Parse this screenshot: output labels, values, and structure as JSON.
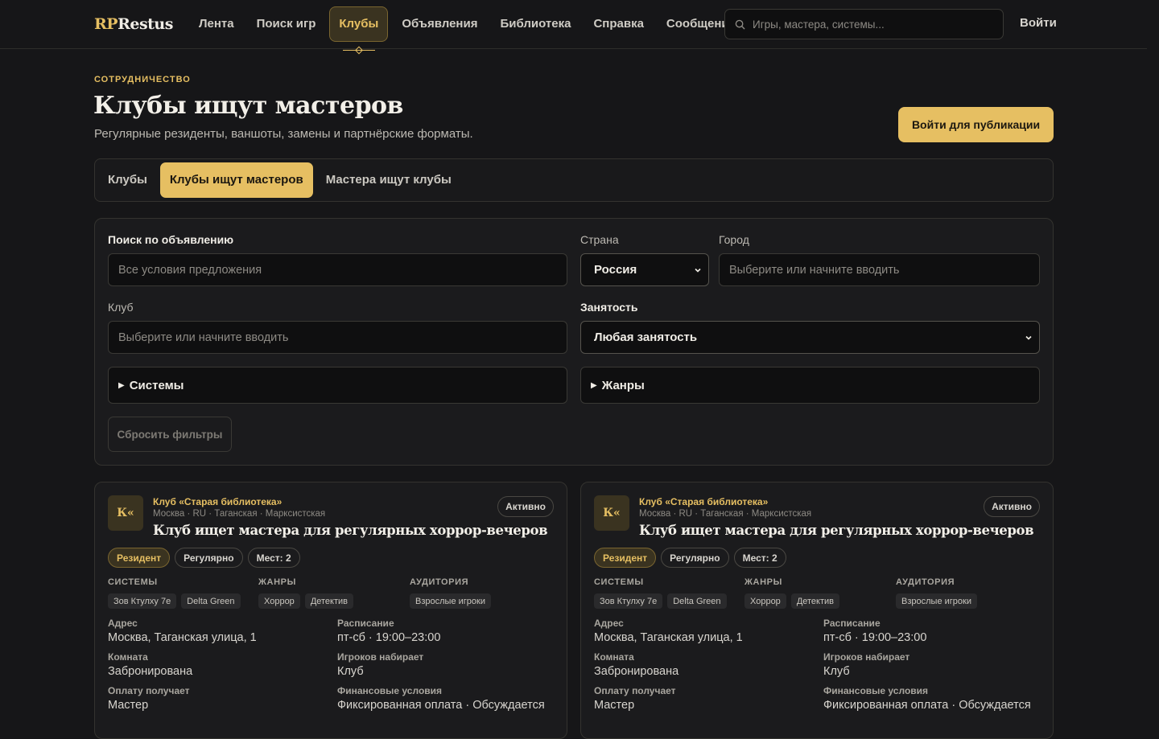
{
  "header": {
    "logo_accent": "RP",
    "logo_main": "Restus",
    "nav": [
      "Лента",
      "Поиск игр",
      "Клубы",
      "Объявления",
      "Библиотека",
      "Справка",
      "Сообщения"
    ],
    "active_nav": "Клубы",
    "search_placeholder": "Игры, мастера, системы...",
    "login": "Войти"
  },
  "intro": {
    "overline": "СОТРУДНИЧЕСТВО",
    "title": "Клубы ищут мастеров",
    "subtitle": "Регулярные резиденты, ваншоты, замены и партнёрские форматы.",
    "publish_button": "Войти для публикации"
  },
  "tabs": [
    "Клубы",
    "Клубы ищут мастеров",
    "Мастера ищут клубы"
  ],
  "active_tab": "Клубы ищут мастеров",
  "filters": {
    "search_label": "Поиск по объявлению",
    "search_placeholder": "Все условия предложения",
    "country_label": "Страна",
    "country_value": "Россия",
    "city_label": "Город",
    "city_placeholder": "Выберите или начните вводить",
    "club_label": "Клуб",
    "club_placeholder": "Выберите или начните вводить",
    "employment_label": "Занятость",
    "employment_value": "Любая занятость",
    "systems": "Системы",
    "genres": "Жанры",
    "reset": "Сбросить фильтры"
  },
  "cards": [
    {
      "avatar": "К«",
      "club": "Клуб «Старая библиотека»",
      "location": "Москва · RU · Таганская · Марксистская",
      "title": "Клуб ищет мастера для регулярных хоррор-вечеров",
      "status": "Активно",
      "chips": [
        "Резидент",
        "Регулярно",
        "Мест: 2"
      ],
      "systems_label": "СИСТЕМЫ",
      "systems": [
        "Зов Ктулху 7е",
        "Delta Green"
      ],
      "genres_label": "ЖАНРЫ",
      "genres": [
        "Хоррор",
        "Детектив"
      ],
      "audience_label": "АУДИТОРИЯ",
      "audience": [
        "Взрослые игроки"
      ],
      "address_label": "Адрес",
      "address": "Москва, Таганская улица, 1",
      "schedule_label": "Расписание",
      "schedule": "пт-сб · 19:00–23:00",
      "room_label": "Комната",
      "room": "Забронирована",
      "recruit_label": "Игроков набирает",
      "recruit": "Клуб",
      "payee_label": "Оплату получает",
      "payee": "Мастер",
      "finance_label": "Финансовые условия",
      "finance": "Фиксированная оплата · Обсуждается"
    },
    {
      "avatar": "К«",
      "club": "Клуб «Старая библиотека»",
      "location": "Москва · RU · Таганская · Марксистская",
      "title": "Клуб ищет мастера для регулярных хоррор-вечеров",
      "status": "Активно",
      "chips": [
        "Резидент",
        "Регулярно",
        "Мест: 2"
      ],
      "systems_label": "СИСТЕМЫ",
      "systems": [
        "Зов Ктулху 7е",
        "Delta Green"
      ],
      "genres_label": "ЖАНРЫ",
      "genres": [
        "Хоррор",
        "Детектив"
      ],
      "audience_label": "АУДИТОРИЯ",
      "audience": [
        "Взрослые игроки"
      ],
      "address_label": "Адрес",
      "address": "Москва, Таганская улица, 1",
      "schedule_label": "Расписание",
      "schedule": "пт-сб · 19:00–23:00",
      "room_label": "Комната",
      "room": "Забронирована",
      "recruit_label": "Игроков набирает",
      "recruit": "Клуб",
      "payee_label": "Оплату получает",
      "payee": "Мастер",
      "finance_label": "Финансовые условия",
      "finance": "Фиксированная оплата · Обсуждается"
    }
  ],
  "colors": {
    "accent": "#e6bf62",
    "background": "#161618",
    "panel": "#1b1b1d"
  }
}
